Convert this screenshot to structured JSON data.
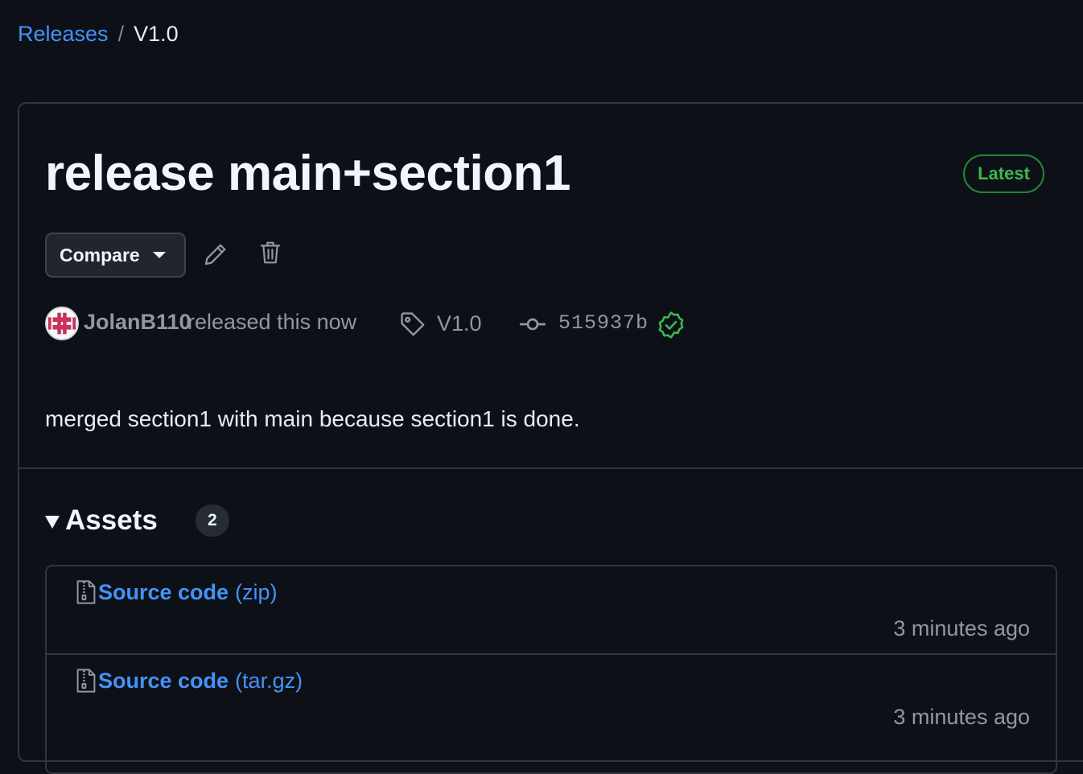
{
  "breadcrumb": {
    "parent": "Releases",
    "separator": "/",
    "current": "V1.0"
  },
  "release": {
    "title": "release main+section1",
    "badge": "Latest",
    "compare_label": "Compare",
    "author": "JolanB110",
    "released_text": "released this now",
    "tag": "V1.0",
    "commit": "515937b",
    "body": "merged section1 with main because section1 is done."
  },
  "assets": {
    "title": "Assets",
    "count": "2",
    "items": [
      {
        "name": "Source code",
        "ext": "(zip)",
        "time": "3 minutes ago"
      },
      {
        "name": "Source code",
        "ext": "(tar.gz)",
        "time": "3 minutes ago"
      }
    ]
  },
  "icons": {
    "edit": "pencil-icon",
    "delete": "trash-icon",
    "tag": "tag-icon",
    "commit": "git-commit-icon",
    "verified": "verified-check-icon",
    "file": "file-zip-icon"
  },
  "colors": {
    "background": "#0d1117",
    "link": "#4493f8",
    "success": "#3fb950",
    "border": "#30363d",
    "muted": "#9198a1"
  }
}
